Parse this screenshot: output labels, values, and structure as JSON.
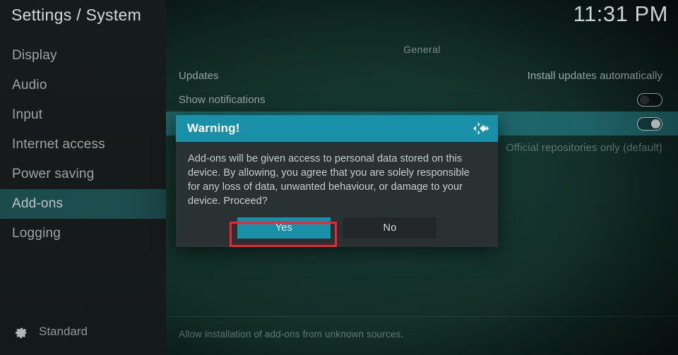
{
  "topbar": {
    "title": "Settings / System",
    "clock": "11:31 PM"
  },
  "sidebar": {
    "items": [
      {
        "label": "Display",
        "selected": false
      },
      {
        "label": "Audio",
        "selected": false
      },
      {
        "label": "Input",
        "selected": false
      },
      {
        "label": "Internet access",
        "selected": false
      },
      {
        "label": "Power saving",
        "selected": false
      },
      {
        "label": "Add-ons",
        "selected": true
      },
      {
        "label": "Logging",
        "selected": false
      }
    ],
    "profile": {
      "icon": "gear-icon",
      "label": "Standard"
    }
  },
  "content": {
    "section_header": "General",
    "rows": [
      {
        "label": "Updates",
        "value": "Install updates automatically",
        "control": "text",
        "state": "",
        "highlighted": false,
        "dim": false
      },
      {
        "label": "Show notifications",
        "value": "",
        "control": "toggle",
        "state": "off",
        "highlighted": false,
        "dim": false
      },
      {
        "label": "",
        "value": "",
        "control": "toggle",
        "state": "on",
        "highlighted": true,
        "dim": false
      },
      {
        "label": "",
        "value": "Official repositories only (default)",
        "control": "text",
        "state": "",
        "highlighted": false,
        "dim": true
      }
    ]
  },
  "hintbar": {
    "text": "Allow installation of add-ons from unknown sources."
  },
  "dialog": {
    "title": "Warning!",
    "logo_icon": "kodi-logo-icon",
    "message": "Add-ons will be given access to personal data stored on this device. By allowing, you agree that you are solely responsible for any loss of data, unwanted behaviour, or damage to your device. Proceed?",
    "buttons": {
      "yes": "Yes",
      "no": "No"
    },
    "focused_button": "Yes"
  },
  "colors": {
    "accent_teal": "#1a8fa8",
    "focus_red": "#f4232f",
    "sidebar_selected": "#1d4e4f",
    "row_highlight": "#1f6b70",
    "background": "#123028"
  }
}
